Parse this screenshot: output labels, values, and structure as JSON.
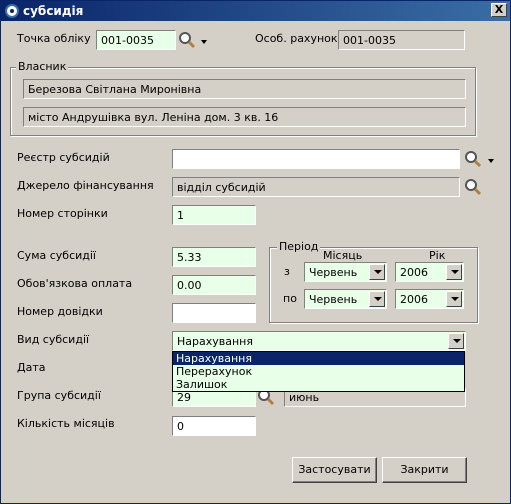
{
  "window": {
    "title": "субсидія",
    "close_label": "X"
  },
  "header": {
    "point_label": "Точка обліку",
    "point_value": "001-0035",
    "account_label": "Особ. рахунок",
    "account_value": "001-0035"
  },
  "owner": {
    "legend": "Власник",
    "name": "Березова Світлана Миронівна",
    "address": "місто Андрушівка вул. Леніна дом. 3 кв. 16"
  },
  "form": {
    "registry_label": "Реєстр субсидій",
    "registry_value": "",
    "source_label": "Джерело фінансування",
    "source_value": "відділ субсидій",
    "page_label": "Номер сторінки",
    "page_value": "1",
    "amount_label": "Сума субсидії",
    "amount_value": "5.33",
    "mandatory_label": "Обов'язкова оплата",
    "mandatory_value": "0.00",
    "certificate_label": "Номер довідки",
    "certificate_value": "",
    "type_label": "Вид субсидії",
    "type_value": "Нарахування",
    "date_label": "Дата",
    "group_label": "Група субсидії",
    "group_value": "29",
    "group_name": "июнь",
    "months_label": "Кількість місяців",
    "months_value": "0"
  },
  "type_options": [
    "Нарахування",
    "Перерахунок",
    "Залишок"
  ],
  "period": {
    "legend": "Період",
    "month_header": "Місяць",
    "year_header": "Рік",
    "from_label": "з",
    "to_label": "по",
    "from_month": "Червень",
    "from_year": "2006",
    "to_month": "Червень",
    "to_year": "2006"
  },
  "buttons": {
    "apply": "Застосувати",
    "close": "Закрити"
  },
  "colors": {
    "title_bar": "#0a246a",
    "editable_field": "#e8ffe8",
    "selection": "#0a246a"
  }
}
